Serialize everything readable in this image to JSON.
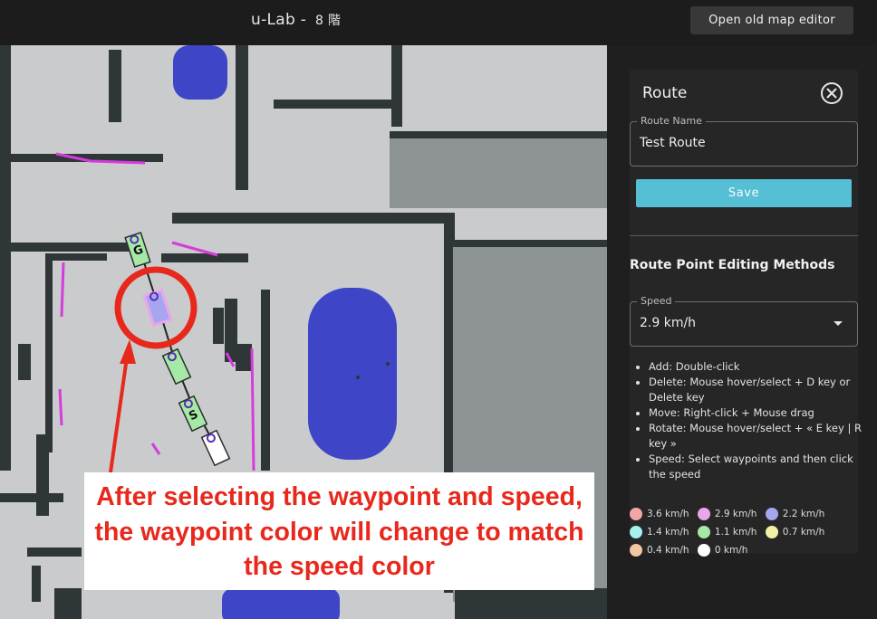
{
  "header": {
    "title": "u-Lab -",
    "floor": "8 階",
    "old_map_editor_label": "Open old map editor"
  },
  "map": {
    "waypoint_labels": [
      "G",
      "S"
    ]
  },
  "route_panel": {
    "title": "Route",
    "close_icon": "close-icon",
    "route_name_label": "Route Name",
    "route_name_value": "Test Route",
    "save_label": "Save",
    "section_title": "Route Point Editing Methods",
    "speed_label": "Speed",
    "speed_value": "2.9 km/h",
    "instructions": [
      "Add: Double-click",
      "Delete: Mouse hover/select + D key or Delete key",
      "Move: Right-click + Mouse drag",
      "Rotate: Mouse hover/select + « E key | R key »",
      "Speed: Select waypoints and then click the speed"
    ],
    "speed_legend": [
      {
        "label": "3.6 km/h",
        "color": "#f2a7a6"
      },
      {
        "label": "2.9 km/h",
        "color": "#e9a6e9"
      },
      {
        "label": "2.2 km/h",
        "color": "#a6a6f0"
      },
      {
        "label": "1.4 km/h",
        "color": "#a6f0f0"
      },
      {
        "label": "1.1 km/h",
        "color": "#a6e9a6"
      },
      {
        "label": "0.7 km/h",
        "color": "#f2f0a6"
      },
      {
        "label": "0.4 km/h",
        "color": "#f2c7a3"
      },
      {
        "label": "0 km/h",
        "color": "#ffffff"
      }
    ]
  },
  "annotation": {
    "callout_text": "After selecting the waypoint and speed, the waypoint color will change to match the speed color"
  },
  "colors": {
    "accent": "#55bfd6",
    "map_floor": "#c9cbcd",
    "map_wall": "#2e3536",
    "blue_zone": "#3e45c6",
    "annotation_red": "#e8281c"
  }
}
